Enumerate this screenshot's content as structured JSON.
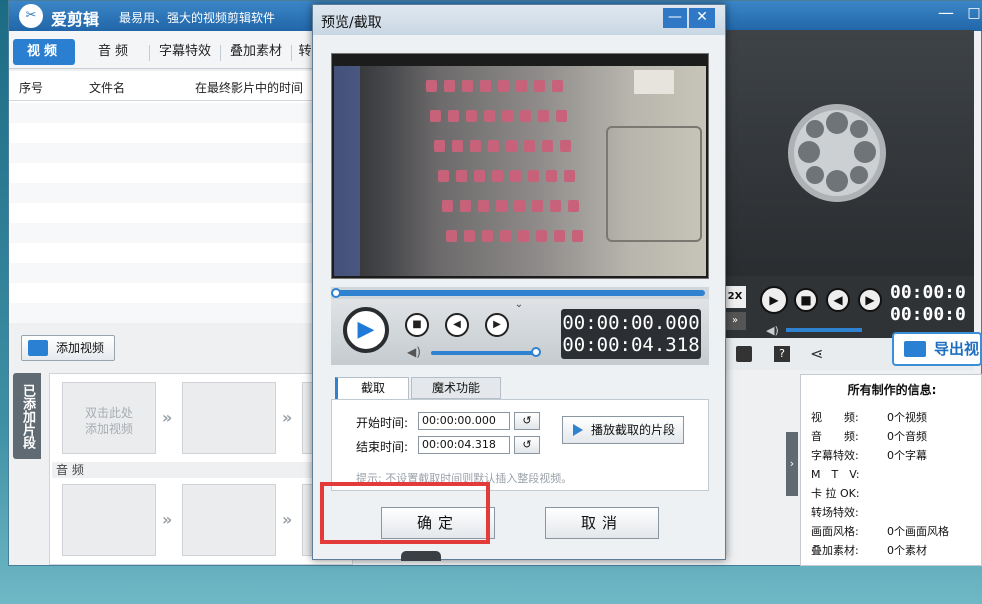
{
  "app": {
    "logo_text": "✂",
    "title": "爱剪辑",
    "slogan": "最易用、强大的视频剪辑软件",
    "minimize": "—",
    "maximize": "□"
  },
  "tabs": [
    {
      "label": "视频"
    },
    {
      "label": "音频"
    },
    {
      "label": "字幕特效"
    },
    {
      "label": "叠加素材"
    },
    {
      "label": "转"
    }
  ],
  "file_list": {
    "columns": [
      "序号",
      "文件名",
      "在最终影片中的时间"
    ]
  },
  "add_video_label": "添加视频",
  "timeline": {
    "side_label": "已添加片段",
    "clip_hint": "双击此处\n添加视频",
    "audio_label": "音 频"
  },
  "right_panel": {
    "time_top": "00:00:0",
    "time_bottom": "00:00:0",
    "speed_label": "2X",
    "export_label": "导出视"
  },
  "info_panel": {
    "title": "所有制作的信息:",
    "rows": [
      {
        "label": "视　　频:",
        "value": "0个视频"
      },
      {
        "label": "音　　频:",
        "value": "0个音频"
      },
      {
        "label": "字幕特效:",
        "value": "0个字幕"
      },
      {
        "label": "M　T　V:",
        "value": ""
      },
      {
        "label": "卡 拉 OK:",
        "value": ""
      },
      {
        "label": "转场特效:",
        "value": ""
      },
      {
        "label": "画面风格:",
        "value": "0个画面风格"
      },
      {
        "label": "叠加素材:",
        "value": "0个素材"
      }
    ]
  },
  "dialog": {
    "title": "预览/截取",
    "minimize": "—",
    "close": "✕",
    "time_current": "00:00:00.000",
    "time_total": "00:00:04.318",
    "tabs": [
      "截取",
      "魔术功能"
    ],
    "start_label": "开始时间:",
    "start_value": "00:00:00.000",
    "end_label": "结束时间:",
    "end_value": "00:00:04.318",
    "play_clip_label": "播放截取的片段",
    "hint": "提示: 不设置截取时间则默认插入整段视频。",
    "ok_label": "确定",
    "cancel_label": "取消"
  }
}
